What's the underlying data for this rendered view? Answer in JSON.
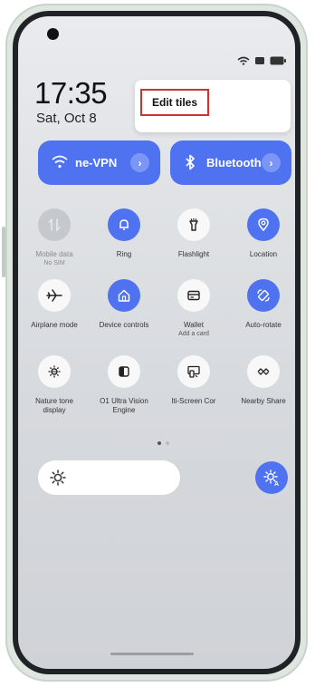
{
  "status_bar": {
    "time": "17:35",
    "date": "Sat, Oct 8"
  },
  "popup_menu": {
    "edit_tiles": "Edit tiles"
  },
  "large_tiles": [
    {
      "label": "ne-VPN",
      "icon": "wifi-icon",
      "active": true
    },
    {
      "label": "Bluetooth",
      "icon": "bluetooth-icon",
      "active": true
    }
  ],
  "tiles": [
    {
      "label": "Mobile data",
      "sub": "No SIM",
      "icon": "mobile-data-icon",
      "state": "disabled"
    },
    {
      "label": "Ring",
      "sub": "",
      "icon": "bell-icon",
      "state": "on"
    },
    {
      "label": "Flashlight",
      "sub": "",
      "icon": "flashlight-icon",
      "state": "off"
    },
    {
      "label": "Location",
      "sub": "",
      "icon": "location-icon",
      "state": "on"
    },
    {
      "label": "Airplane mode",
      "sub": "",
      "icon": "airplane-icon",
      "state": "off"
    },
    {
      "label": "Device controls",
      "sub": "",
      "icon": "home-icon",
      "state": "on"
    },
    {
      "label": "Wallet",
      "sub": "Add a card",
      "icon": "wallet-icon",
      "state": "off"
    },
    {
      "label": "Auto-rotate",
      "sub": "",
      "icon": "rotate-icon",
      "state": "on"
    },
    {
      "label": "Nature tone display",
      "sub": "",
      "icon": "nature-tone-icon",
      "state": "off"
    },
    {
      "label": "O1 Ultra Vision Engine",
      "sub": "",
      "icon": "vision-engine-icon",
      "state": "off"
    },
    {
      "label": "lti-Screen Cor",
      "sub": "",
      "icon": "multi-screen-icon",
      "state": "off"
    },
    {
      "label": "Nearby Share",
      "sub": "",
      "icon": "nearby-share-icon",
      "state": "off"
    }
  ],
  "brightness": {
    "level": 0.6
  },
  "colors": {
    "accent": "#4f73f0",
    "tile_off": "#f8f8f8",
    "highlight": "#d32f2f"
  }
}
